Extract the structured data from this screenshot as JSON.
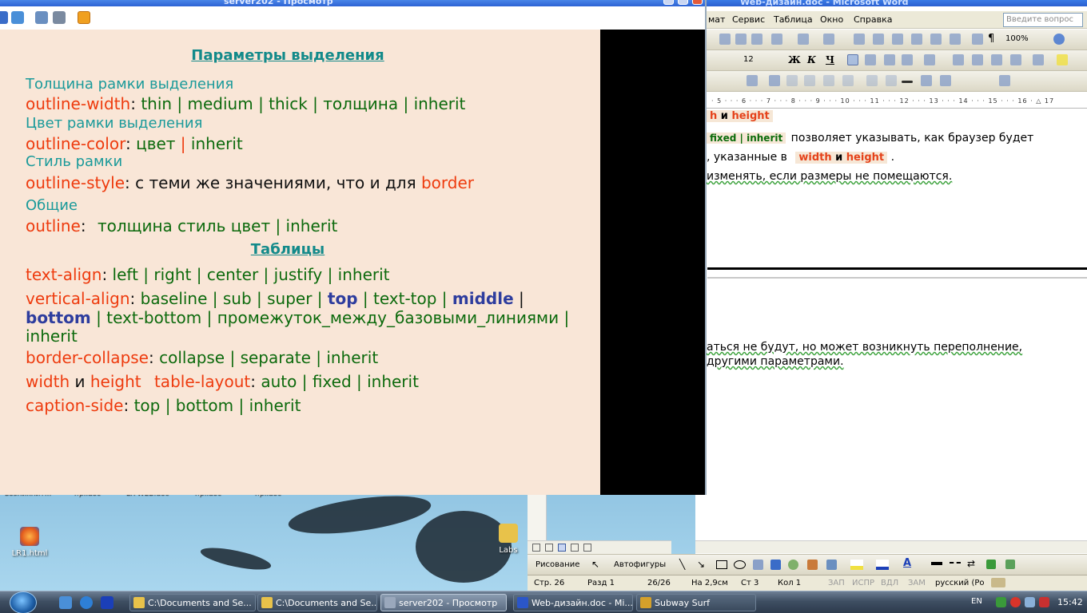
{
  "desktop": {
    "icons": [
      {
        "label": "LR1.html",
        "kind": "firefox"
      },
      {
        "label": "Labs",
        "kind": "folder"
      }
    ],
    "top_labels": [
      "возникнит...",
      "пр.idoc",
      "LR-WEB.doc",
      "пр.idoc",
      "пр.idoc"
    ]
  },
  "viewer": {
    "title": "server202 - Просмотр",
    "slide": {
      "heading1": "Параметры выделения",
      "sub_width": "Толщина рамки выделения",
      "outline_width": {
        "prop": "outline-width",
        "colon": ":",
        "values": "thin | medium | thick | толщина | inherit"
      },
      "sub_color": "Цвет рамки выделения",
      "outline_color": {
        "prop": "outline-color",
        "colon": ":",
        "v1": "цвет",
        "bar": "|",
        "v2": "inherit"
      },
      "sub_style": "Стиль рамки",
      "outline_style": {
        "prop": "outline-style",
        "colon": ":",
        "text": "с теми же значениями, что и для",
        "border": "border"
      },
      "sub_common": "Общие",
      "outline": {
        "prop": "outline",
        "colon": ":",
        "values": "толщина стиль цвет | inherit"
      },
      "heading2": "Таблицы",
      "text_align": {
        "prop": "text-align",
        "colon": ":",
        "values": "left | right | center | justify | inherit"
      },
      "vertical_align": {
        "prop": "vertical-align",
        "colon": ":",
        "v1": "baseline | sub | super |",
        "top": "top",
        "v2": "| text-top |",
        "middle": "middle",
        "v3": "|",
        "bottom": "bottom",
        "v4": "| text-bottom | промежуток_между_базовыми_линиями |",
        "v5": "inherit"
      },
      "border_collapse": {
        "prop": "border-collapse",
        "colon": ":",
        "values": "collapse | separate | inherit"
      },
      "table_layout": {
        "width": "width",
        "and": "и",
        "height": "height",
        "prop": "table-layout",
        "colon": ":",
        "values": "auto | fixed | inherit"
      },
      "caption_side": {
        "prop": "caption-side",
        "colon": ":",
        "values": "top | bottom | inherit"
      }
    }
  },
  "word": {
    "title": "Web-дизайн.doc - Microsoft Word",
    "menu": [
      "мат",
      "Сервис",
      "Таблица",
      "Окно",
      "Справка"
    ],
    "help_placeholder": "Введите вопрос",
    "zoom": "100%",
    "font_size": "12",
    "bold_label": "Ж",
    "italic_label": "К",
    "underline_label": "Ч",
    "ruler_numbers": "· 5 · · · 6 · · · 7 · · · 8 · · · 9 · · · 10 · · · 11 · · · 12 · · · 13 · · · 14 · · · 15 · · · 16 · △ 17",
    "doc": {
      "l1_h": "h",
      "l1_and": "и",
      "l1_height": "height",
      "l2_fixed": "fixed | inherit",
      "l2_text": "позволяет указывать, как браузер будет",
      "l3_text": ", указанные в",
      "l3_width": "width",
      "l3_and": "и",
      "l3_height": "height",
      "l3_dot": ".",
      "l4_text": "изменять, если размеры не помещаются.",
      "l5_text": "аться не будут, но может возникнуть переполнение,",
      "l6_text": "другими параметрами."
    },
    "draw": {
      "drawing": "Рисование",
      "autoshapes": "Автофигуры"
    },
    "status": {
      "page": "Стр. 26",
      "section": "Разд 1",
      "pages": "26/26",
      "at": "На 2,9см",
      "line": "Ст 3",
      "col": "Кол 1",
      "rec": "ЗАП",
      "trk": "ИСПР",
      "ext": "ВДЛ",
      "ovr": "ЗАМ",
      "lang": "русский (Ро"
    }
  },
  "taskbar": {
    "tasks": [
      {
        "label": "C:\\Documents and Se...",
        "active": false
      },
      {
        "label": "C:\\Documents and Se...",
        "active": false
      },
      {
        "label": "server202 - Просмотр",
        "active": true
      },
      {
        "label": "Web-дизайн.doc - Mi...",
        "active": false
      },
      {
        "label": "Subway Surf",
        "active": false
      }
    ],
    "lang": "EN",
    "clock": "15:42"
  },
  "colors": {
    "slide_bg": "#f9e6d7",
    "prop_red": "#ee3b0e",
    "value_green": "#0d6a0d",
    "teal": "#1a9a9a",
    "blue": "#2e3d9e"
  }
}
